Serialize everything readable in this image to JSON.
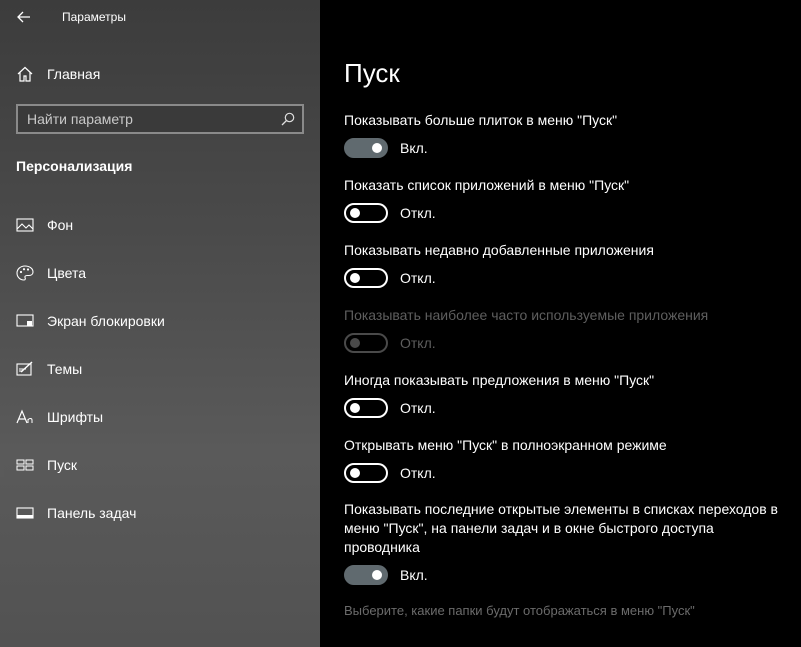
{
  "window": {
    "title": "Параметры"
  },
  "sidebar": {
    "home_label": "Главная",
    "search_placeholder": "Найти параметр",
    "section_title": "Персонализация",
    "items": [
      {
        "label": "Фон",
        "icon": "picture-icon"
      },
      {
        "label": "Цвета",
        "icon": "palette-icon"
      },
      {
        "label": "Экран блокировки",
        "icon": "lock-screen-icon"
      },
      {
        "label": "Темы",
        "icon": "themes-icon"
      },
      {
        "label": "Шрифты",
        "icon": "fonts-icon"
      },
      {
        "label": "Пуск",
        "icon": "start-icon",
        "active": true
      },
      {
        "label": "Панель задач",
        "icon": "taskbar-icon"
      }
    ]
  },
  "main": {
    "title": "Пуск",
    "settings": [
      {
        "label": "Показывать больше плиток в меню \"Пуск\"",
        "state": "Вкл.",
        "on": true,
        "disabled": false
      },
      {
        "label": "Показать список приложений в меню \"Пуск\"",
        "state": "Откл.",
        "on": false,
        "disabled": false
      },
      {
        "label": "Показывать недавно добавленные приложения",
        "state": "Откл.",
        "on": false,
        "disabled": false
      },
      {
        "label": "Показывать наиболее часто используемые приложения",
        "state": "Откл.",
        "on": false,
        "disabled": true
      },
      {
        "label": "Иногда показывать предложения в меню \"Пуск\"",
        "state": "Откл.",
        "on": false,
        "disabled": false
      },
      {
        "label": "Открывать меню \"Пуск\" в полноэкранном режиме",
        "state": "Откл.",
        "on": false,
        "disabled": false
      },
      {
        "label": "Показывать последние открытые элементы в списках переходов в меню \"Пуск\", на панели задач и в окне быстрого доступа проводника",
        "state": "Вкл.",
        "on": true,
        "disabled": false
      }
    ],
    "folders_link": "Выберите, какие папки будут отображаться в меню \"Пуск\""
  },
  "colors": {
    "sidebar_bg": "#4a4a4a",
    "main_bg": "#000000",
    "toggle_on": "#606a6f",
    "disabled_text": "#5e5e5e"
  }
}
